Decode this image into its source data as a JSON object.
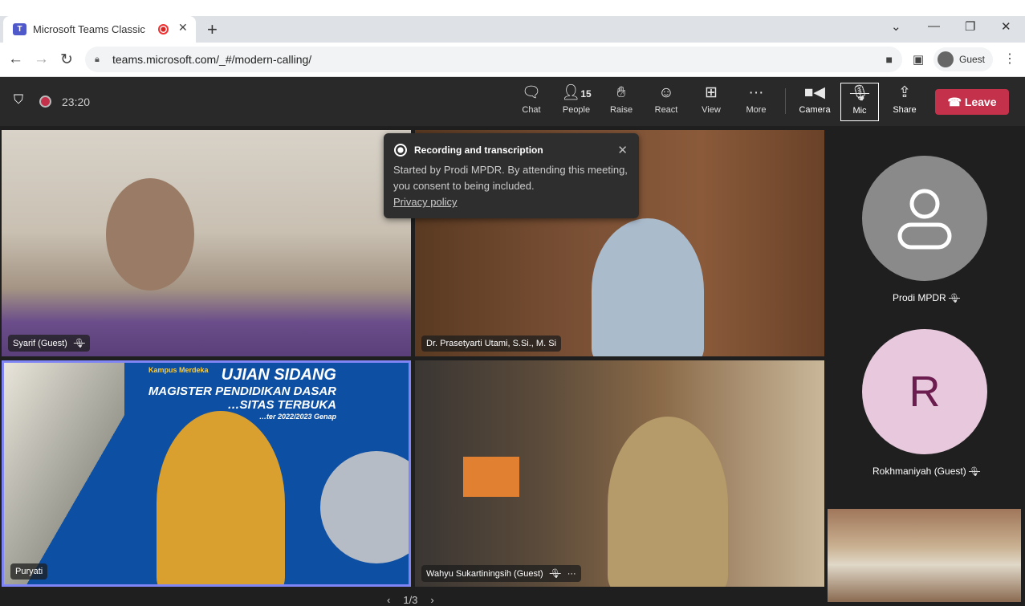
{
  "browser": {
    "tab_title": "Microsoft Teams Classic",
    "url": "teams.microsoft.com/_#/modern-calling/",
    "profile": "Guest"
  },
  "meeting": {
    "timer": "23:20",
    "toolbar": [
      {
        "label": "Chat",
        "icon": "chat-icon"
      },
      {
        "label": "People",
        "icon": "people-icon",
        "count": "15"
      },
      {
        "label": "Raise",
        "icon": "hand-icon"
      },
      {
        "label": "React",
        "icon": "smiley-icon"
      },
      {
        "label": "View",
        "icon": "layout-icon"
      },
      {
        "label": "More",
        "icon": "more-icon"
      },
      {
        "label": "Camera",
        "icon": "camera-icon"
      },
      {
        "label": "Mic",
        "icon": "mic-off-icon"
      },
      {
        "label": "Share",
        "icon": "share-icon"
      }
    ],
    "leave_label": "Leave"
  },
  "popup": {
    "title": "Recording and transcription",
    "body": "Started by Prodi MPDR. By attending this meeting, you consent to being included.",
    "link": "Privacy policy"
  },
  "tiles": [
    {
      "name": "Syarif (Guest)"
    },
    {
      "name": "Dr. Prasetyarti Utami, S.Si., M. Si"
    },
    {
      "name": "Puryati"
    },
    {
      "name": "Wahyu Sukartiningsih (Guest)"
    }
  ],
  "slide": {
    "line1": "UJIAN SIDANG",
    "line2": "MAGISTER PENDIDIKAN DASAR",
    "line3": "…SITAS TERBUKA",
    "line4": "…ter 2022/2023 Genap",
    "logo": "Kampus Merdeka"
  },
  "side": [
    {
      "name": "Prodi MPDR",
      "initial": ""
    },
    {
      "name": "Rokhmaniyah (Guest)",
      "initial": "R"
    }
  ],
  "pager": "1/3",
  "colors": {
    "leave": "#c4314b",
    "active_speaker": "#7f85f5",
    "avatar_r_bg": "#e8c8dc",
    "avatar_r_fg": "#6b1d4f"
  }
}
